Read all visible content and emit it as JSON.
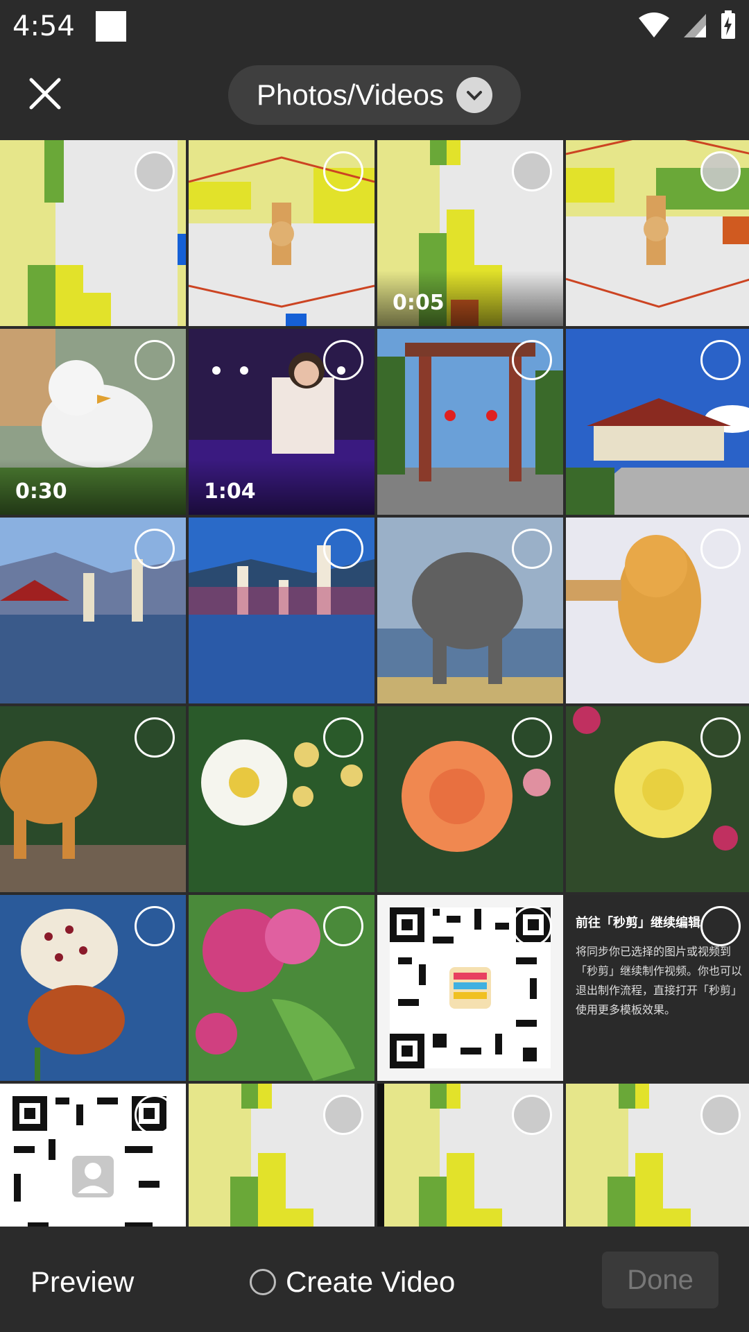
{
  "status": {
    "time": "4:54"
  },
  "header": {
    "album_label": "Photos/Videos"
  },
  "grid": {
    "durations": {
      "c3": "0:05",
      "c5": "0:30",
      "c6": "1:04"
    },
    "promo": {
      "title": "前往「秒剪」继续编辑",
      "body": "将同步你已选择的图片或视频到「秒剪」继续制作视频。你也可以退出制作流程，直接打开「秒剪」使用更多模板效果。"
    }
  },
  "bottom": {
    "preview_label": "Preview",
    "create_video_label": "Create Video",
    "done_label": "Done"
  },
  "colors": {
    "background": "#2b2b2b",
    "pill": "#3f3f3f",
    "accent_yellow": "#e6e85a",
    "accent_green": "#6aa838"
  }
}
